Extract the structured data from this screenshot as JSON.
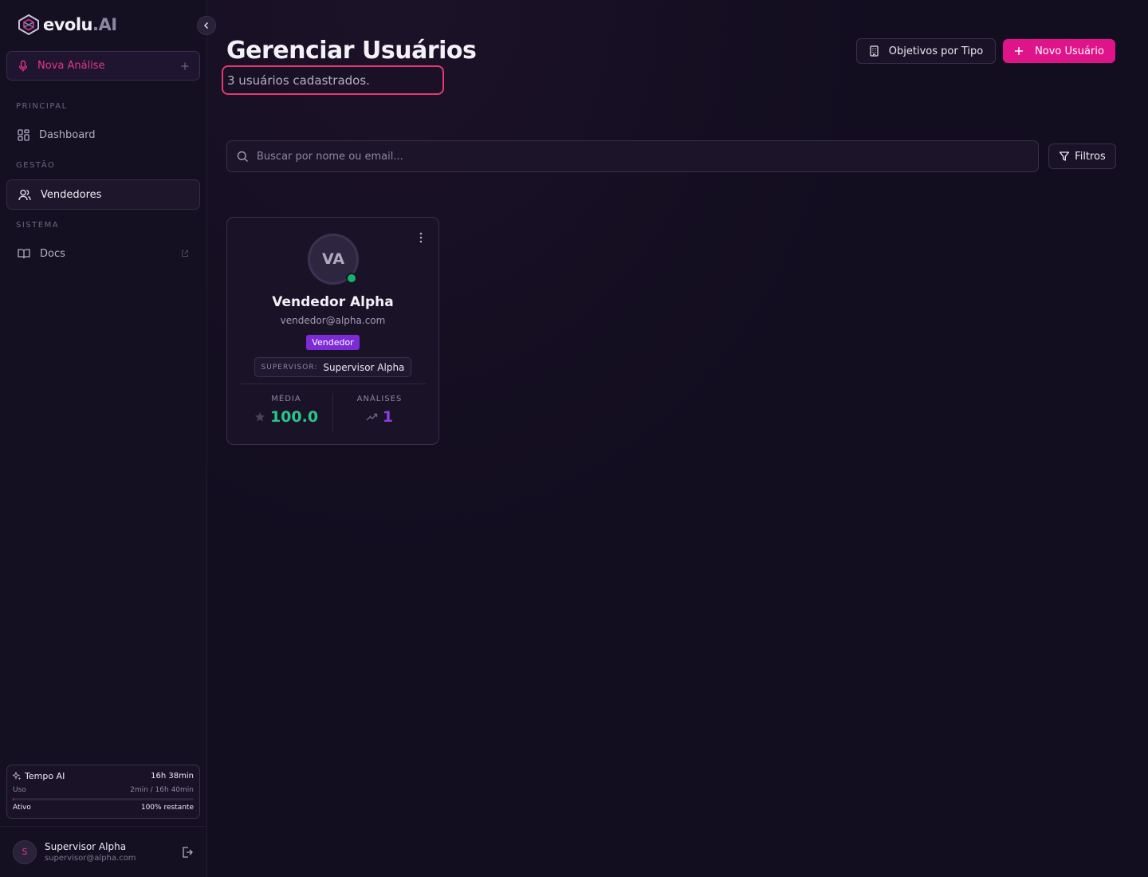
{
  "brand": {
    "name": "evolu",
    "suffix": ".AI"
  },
  "sidebar": {
    "nova_analise": "Nova Análise",
    "sections": {
      "principal": "PRINCIPAL",
      "gestao": "GESTÃO",
      "sistema": "SISTEMA"
    },
    "items": {
      "dashboard": "Dashboard",
      "vendedores": "Vendedores",
      "docs": "Docs"
    },
    "active": "vendedores"
  },
  "tempo": {
    "title": "Tempo AI",
    "total": "16h 38min",
    "uso_label": "Uso",
    "uso_value": "2min / 16h 40min",
    "usage_fraction": 0.002,
    "status": "Ativo",
    "remaining": "100% restante"
  },
  "current_user": {
    "initial": "S",
    "name": "Supervisor Alpha",
    "email": "supervisor@alpha.com"
  },
  "page": {
    "title": "Gerenciar Usuários",
    "subtitle": "3 usuários cadastrados.",
    "btn_objetivos": "Objetivos por Tipo",
    "btn_novo": "Novo Usuário",
    "search_placeholder": "Buscar por nome ou email...",
    "btn_filtros": "Filtros"
  },
  "users": [
    {
      "initials": "VA",
      "name": "Vendedor Alpha",
      "email": "vendedor@alpha.com",
      "role": "Vendedor",
      "supervisor_label": "SUPERVISOR:",
      "supervisor": "Supervisor Alpha",
      "media_label": "MÉDIA",
      "media": "100.0",
      "analises_label": "ANÁLISES",
      "analises": "1",
      "online": true
    }
  ],
  "colors": {
    "accent": "#e0148a",
    "role_badge": "#7c2bd6",
    "media": "#2bc48a",
    "analises": "#8b3fe0",
    "online": "#17b26a"
  }
}
